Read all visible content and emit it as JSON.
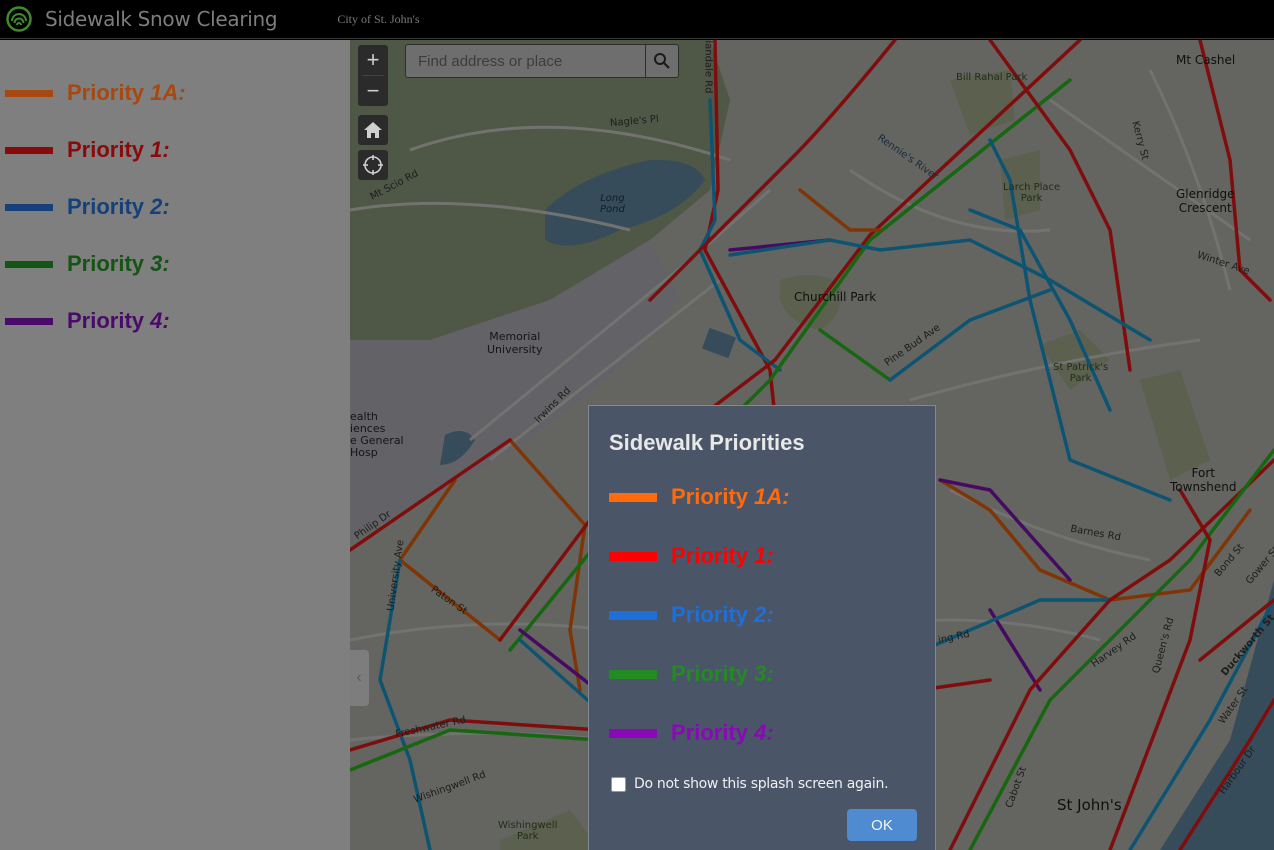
{
  "header": {
    "title": "Sidewalk Snow Clearing",
    "subtitle": "City of St. John's",
    "logo_icon": "snow-plow-signal-icon"
  },
  "sidebar": {
    "legend": [
      {
        "prefix": "Priority",
        "num": "1A:",
        "color": "#a8470f"
      },
      {
        "prefix": "Priority",
        "num": "1:",
        "color": "#8a0a0a"
      },
      {
        "prefix": "Priority",
        "num": "2:",
        "color": "#16407a"
      },
      {
        "prefix": "Priority",
        "num": "3:",
        "color": "#145414"
      },
      {
        "prefix": "Priority",
        "num": "4:",
        "color": "#4a0a6a"
      }
    ]
  },
  "map": {
    "zoom_in": "+",
    "zoom_out": "−",
    "home_icon": "home-icon",
    "locate_icon": "locate-icon",
    "search": {
      "placeholder": "Find address or place",
      "value": ""
    },
    "collapse_glyph": "‹",
    "labels": {
      "nagles_pl": "Nagle's Pl",
      "mt_scio_rd": "Mt Scio Rd",
      "long_pond_1": "Long",
      "long_pond_2": "Pond",
      "memorial_1": "Memorial",
      "memorial_2": "University",
      "health_1": "ealth",
      "health_2": "iences",
      "health_3": "e General",
      "health_4": "Hosp",
      "irwins_rd": "Irwins Rd",
      "philip_dr": "Philip Dr",
      "university_ave": "University Ave",
      "paton_st": "Paton St",
      "freshwater_rd": "Freshwater Rd",
      "wishingwell_rd": "Wishingwell Rd",
      "wishingwell_park_1": "Wishingwell",
      "wishingwell_park_2": "Park",
      "allandale_rd": "llandale Rd",
      "rennies_river": "Rennie's River",
      "churchill_park": "Churchill Park",
      "pine_bud_ave": "Pine Bud Ave",
      "bill_rahal_park": "Bill Rahal Park",
      "larch_1": "Larch Place",
      "larch_2": "Park",
      "kerry_st": "Kerry St",
      "mt_cashel": "Mt Cashel",
      "glenridge_1": "Glenridge",
      "glenridge_2": "Crescent",
      "winter_ave": "Winter Ave",
      "st_patricks_1": "St Patrick's",
      "st_patricks_2": "Park",
      "fort_1": "Fort",
      "fort_2": "Townshend",
      "barnes_rd": "Barnes Rd",
      "bond_st": "Bond St",
      "gower_st": "Gower St",
      "harvey_rd": "Harvey Rd",
      "queens_rd": "Queen's Rd",
      "duckworth_st": "Duckworth St",
      "water_st": "Water St",
      "harbour_dr": "Harbour Dr",
      "cabot_st": "Cabot St",
      "st_johns": "St John's",
      "king_rd": "ing Rd"
    }
  },
  "splash": {
    "title": "Sidewalk Priorities",
    "items": [
      {
        "prefix": "Priority",
        "num": "1A:",
        "color": "#ff6a0d"
      },
      {
        "prefix": "Priority",
        "num": "1:",
        "color": "#ff0000"
      },
      {
        "prefix": "Priority",
        "num": "2:",
        "color": "#1f6fd6"
      },
      {
        "prefix": "Priority",
        "num": "3:",
        "color": "#228b22"
      },
      {
        "prefix": "Priority",
        "num": "4:",
        "color": "#8a08b8"
      }
    ],
    "checkbox_label": "Do not show this splash screen again.",
    "checkbox_checked": false,
    "ok_label": "OK"
  }
}
